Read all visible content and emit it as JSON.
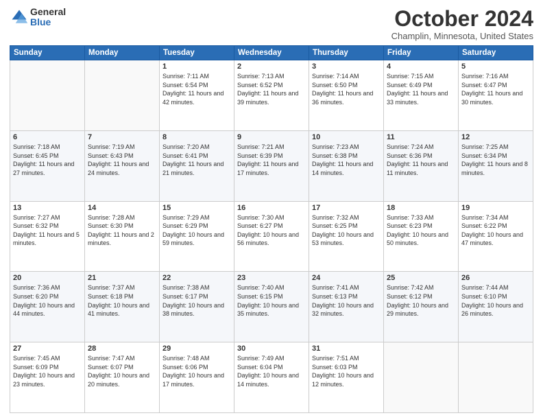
{
  "header": {
    "logo_general": "General",
    "logo_blue": "Blue",
    "month_title": "October 2024",
    "location": "Champlin, Minnesota, United States"
  },
  "days_of_week": [
    "Sunday",
    "Monday",
    "Tuesday",
    "Wednesday",
    "Thursday",
    "Friday",
    "Saturday"
  ],
  "weeks": [
    [
      {
        "day": "",
        "detail": ""
      },
      {
        "day": "",
        "detail": ""
      },
      {
        "day": "1",
        "detail": "Sunrise: 7:11 AM\nSunset: 6:54 PM\nDaylight: 11 hours and 42 minutes."
      },
      {
        "day": "2",
        "detail": "Sunrise: 7:13 AM\nSunset: 6:52 PM\nDaylight: 11 hours and 39 minutes."
      },
      {
        "day": "3",
        "detail": "Sunrise: 7:14 AM\nSunset: 6:50 PM\nDaylight: 11 hours and 36 minutes."
      },
      {
        "day": "4",
        "detail": "Sunrise: 7:15 AM\nSunset: 6:49 PM\nDaylight: 11 hours and 33 minutes."
      },
      {
        "day": "5",
        "detail": "Sunrise: 7:16 AM\nSunset: 6:47 PM\nDaylight: 11 hours and 30 minutes."
      }
    ],
    [
      {
        "day": "6",
        "detail": "Sunrise: 7:18 AM\nSunset: 6:45 PM\nDaylight: 11 hours and 27 minutes."
      },
      {
        "day": "7",
        "detail": "Sunrise: 7:19 AM\nSunset: 6:43 PM\nDaylight: 11 hours and 24 minutes."
      },
      {
        "day": "8",
        "detail": "Sunrise: 7:20 AM\nSunset: 6:41 PM\nDaylight: 11 hours and 21 minutes."
      },
      {
        "day": "9",
        "detail": "Sunrise: 7:21 AM\nSunset: 6:39 PM\nDaylight: 11 hours and 17 minutes."
      },
      {
        "day": "10",
        "detail": "Sunrise: 7:23 AM\nSunset: 6:38 PM\nDaylight: 11 hours and 14 minutes."
      },
      {
        "day": "11",
        "detail": "Sunrise: 7:24 AM\nSunset: 6:36 PM\nDaylight: 11 hours and 11 minutes."
      },
      {
        "day": "12",
        "detail": "Sunrise: 7:25 AM\nSunset: 6:34 PM\nDaylight: 11 hours and 8 minutes."
      }
    ],
    [
      {
        "day": "13",
        "detail": "Sunrise: 7:27 AM\nSunset: 6:32 PM\nDaylight: 11 hours and 5 minutes."
      },
      {
        "day": "14",
        "detail": "Sunrise: 7:28 AM\nSunset: 6:30 PM\nDaylight: 11 hours and 2 minutes."
      },
      {
        "day": "15",
        "detail": "Sunrise: 7:29 AM\nSunset: 6:29 PM\nDaylight: 10 hours and 59 minutes."
      },
      {
        "day": "16",
        "detail": "Sunrise: 7:30 AM\nSunset: 6:27 PM\nDaylight: 10 hours and 56 minutes."
      },
      {
        "day": "17",
        "detail": "Sunrise: 7:32 AM\nSunset: 6:25 PM\nDaylight: 10 hours and 53 minutes."
      },
      {
        "day": "18",
        "detail": "Sunrise: 7:33 AM\nSunset: 6:23 PM\nDaylight: 10 hours and 50 minutes."
      },
      {
        "day": "19",
        "detail": "Sunrise: 7:34 AM\nSunset: 6:22 PM\nDaylight: 10 hours and 47 minutes."
      }
    ],
    [
      {
        "day": "20",
        "detail": "Sunrise: 7:36 AM\nSunset: 6:20 PM\nDaylight: 10 hours and 44 minutes."
      },
      {
        "day": "21",
        "detail": "Sunrise: 7:37 AM\nSunset: 6:18 PM\nDaylight: 10 hours and 41 minutes."
      },
      {
        "day": "22",
        "detail": "Sunrise: 7:38 AM\nSunset: 6:17 PM\nDaylight: 10 hours and 38 minutes."
      },
      {
        "day": "23",
        "detail": "Sunrise: 7:40 AM\nSunset: 6:15 PM\nDaylight: 10 hours and 35 minutes."
      },
      {
        "day": "24",
        "detail": "Sunrise: 7:41 AM\nSunset: 6:13 PM\nDaylight: 10 hours and 32 minutes."
      },
      {
        "day": "25",
        "detail": "Sunrise: 7:42 AM\nSunset: 6:12 PM\nDaylight: 10 hours and 29 minutes."
      },
      {
        "day": "26",
        "detail": "Sunrise: 7:44 AM\nSunset: 6:10 PM\nDaylight: 10 hours and 26 minutes."
      }
    ],
    [
      {
        "day": "27",
        "detail": "Sunrise: 7:45 AM\nSunset: 6:09 PM\nDaylight: 10 hours and 23 minutes."
      },
      {
        "day": "28",
        "detail": "Sunrise: 7:47 AM\nSunset: 6:07 PM\nDaylight: 10 hours and 20 minutes."
      },
      {
        "day": "29",
        "detail": "Sunrise: 7:48 AM\nSunset: 6:06 PM\nDaylight: 10 hours and 17 minutes."
      },
      {
        "day": "30",
        "detail": "Sunrise: 7:49 AM\nSunset: 6:04 PM\nDaylight: 10 hours and 14 minutes."
      },
      {
        "day": "31",
        "detail": "Sunrise: 7:51 AM\nSunset: 6:03 PM\nDaylight: 10 hours and 12 minutes."
      },
      {
        "day": "",
        "detail": ""
      },
      {
        "day": "",
        "detail": ""
      }
    ]
  ]
}
